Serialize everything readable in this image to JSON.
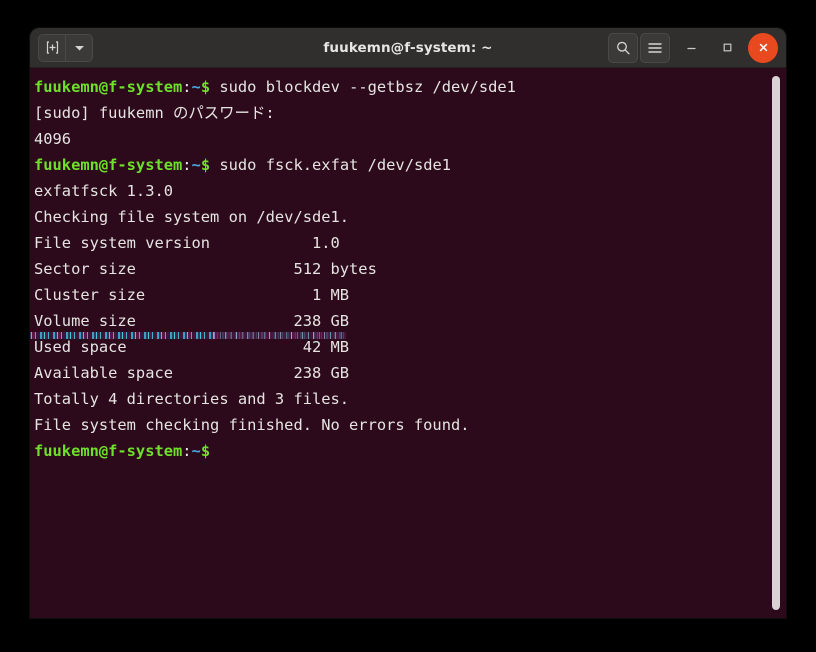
{
  "window": {
    "title": "fuukemn@f-system: ~",
    "titlebar_bg": "#302f2d",
    "terminal_bg": "#2c0a1c",
    "close_button_color": "#e8491f",
    "prompt_color": "#6ee02a",
    "path_color": "#49a6e0"
  },
  "titlebar": {
    "new_tab_label": "new-tab",
    "tab_menu_label": "tab-menu",
    "search_label": "search",
    "menu_label": "main-menu",
    "minimize_label": "minimize",
    "maximize_label": "maximize",
    "close_label": "close"
  },
  "terminal": {
    "prompt": {
      "user_host": "fuukemn@f-system",
      "separator": ":",
      "path": "~",
      "dollar": "$"
    },
    "lines": [
      {
        "type": "prompt",
        "command": " sudo blockdev --getbsz /dev/sde1"
      },
      {
        "type": "output",
        "text": "[sudo] fuukemn のパスワード:"
      },
      {
        "type": "output",
        "text": "4096"
      },
      {
        "type": "prompt",
        "command": " sudo fsck.exfat /dev/sde1"
      },
      {
        "type": "output",
        "text": "exfatfsck 1.3.0"
      },
      {
        "type": "output",
        "text": "Checking file system on /dev/sde1."
      },
      {
        "type": "output",
        "text": "File system version           1.0"
      },
      {
        "type": "output",
        "text": "Sector size                 512 bytes"
      },
      {
        "type": "output",
        "text": "Cluster size                  1 MB"
      },
      {
        "type": "output",
        "text": "Volume size                 238 GB"
      },
      {
        "type": "output",
        "text": "Used space                   42 MB"
      },
      {
        "type": "output",
        "text": "Available space             238 GB"
      },
      {
        "type": "output",
        "text": "Totally 4 directories and 3 files."
      },
      {
        "type": "output",
        "text": "File system checking finished. No errors found."
      },
      {
        "type": "prompt",
        "command": ""
      }
    ]
  }
}
